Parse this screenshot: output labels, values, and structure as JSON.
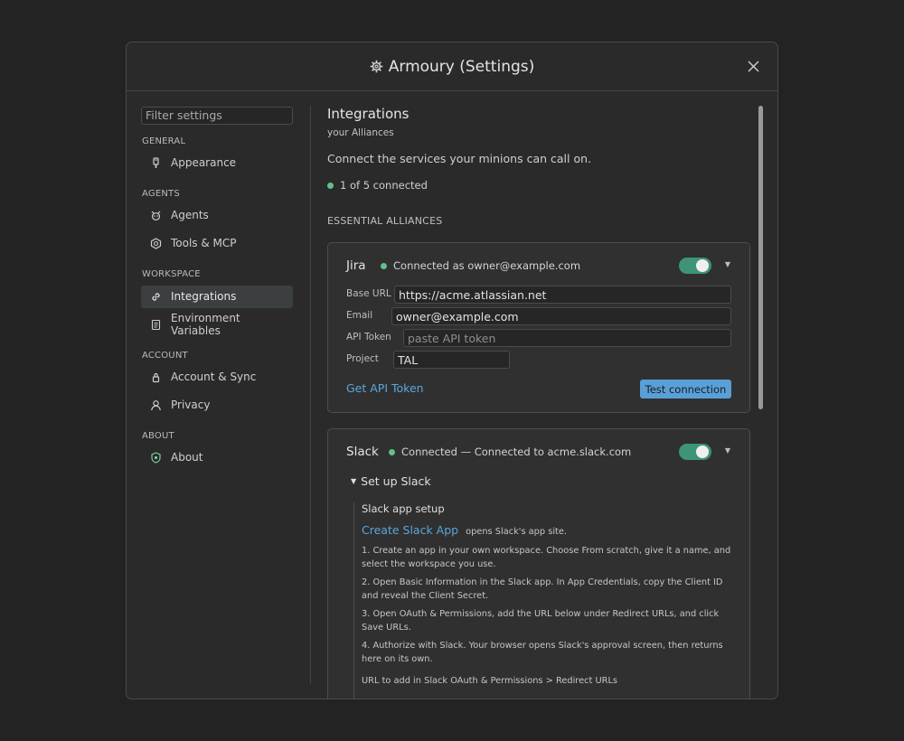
{
  "window": {
    "title": "Armoury (Settings)"
  },
  "sidebar": {
    "filter_placeholder": "Filter settings",
    "sections": [
      {
        "heading": "GENERAL",
        "items": [
          {
            "label": "Appearance",
            "icon": "brush-icon"
          }
        ]
      },
      {
        "heading": "AGENTS",
        "items": [
          {
            "label": "Agents",
            "icon": "agent-icon"
          },
          {
            "label": "Tools & MCP",
            "icon": "tools-icon"
          }
        ]
      },
      {
        "heading": "WORKSPACE",
        "items": [
          {
            "label": "Integrations",
            "icon": "link-icon",
            "active": true
          },
          {
            "label": "Environment Variables",
            "icon": "scroll-icon"
          }
        ]
      },
      {
        "heading": "ACCOUNT",
        "items": [
          {
            "label": "Account & Sync",
            "icon": "key-icon"
          },
          {
            "label": "Privacy",
            "icon": "person-icon"
          }
        ]
      },
      {
        "heading": "ABOUT",
        "items": [
          {
            "label": "About",
            "icon": "shield-icon"
          }
        ]
      }
    ]
  },
  "main": {
    "title": "Integrations",
    "subtitle": "your Alliances",
    "description": "Connect the services your minions can call on.",
    "status": "1 of 5 connected",
    "section_label": "ESSENTIAL ALLIANCES"
  },
  "jira": {
    "name": "Jira",
    "status": "Connected as owner@example.com",
    "enabled": true,
    "fields": {
      "base_url_label": "Base URL",
      "base_url": "https://acme.atlassian.net",
      "email_label": "Email",
      "email": "owner@example.com",
      "token_label": "API Token",
      "token_placeholder": "paste API token",
      "project_label": "Project",
      "project": "TAL"
    },
    "link": "Get API Token",
    "test_button": "Test connection"
  },
  "slack": {
    "name": "Slack",
    "status": "Connected — Connected to acme.slack.com",
    "enabled": true,
    "setup_toggle": "Set up Slack",
    "setup_title": "Slack app setup",
    "create_link": "Create Slack App",
    "create_hint": "opens Slack's app site.",
    "steps": [
      "1.   Create an app in your own workspace. Choose From scratch, give it a name, and select the workspace you use.",
      "2.   Open Basic Information in the Slack app. In App Credentials, copy the Client ID and reveal the Client Secret.",
      "3.   Open OAuth & Permissions, add the URL below under Redirect URLs, and click Save URLs.",
      "4.   Authorize with Slack. Your browser opens Slack's approval screen, then returns here on its own."
    ],
    "redirect_label": "URL to add in Slack OAuth & Permissions > Redirect URLs"
  },
  "colors": {
    "accent": "#5aa6dc",
    "toggle_on": "#3d9478",
    "status_ok": "#62c08c",
    "background": "#2a2a2a"
  }
}
